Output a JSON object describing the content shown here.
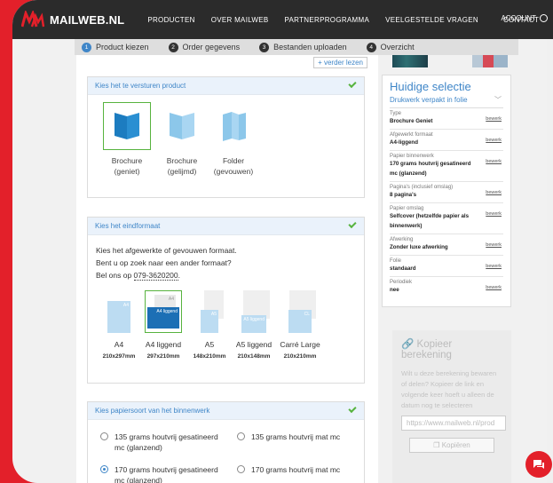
{
  "nav": {
    "brand": "MAILWEB.NL",
    "links": [
      "PRODUCTEN",
      "OVER MAILWEB",
      "PARTNERPROGRAMMA",
      "VEELGESTELDE VRAGEN",
      "CONTACT"
    ],
    "account": "ACCOUNT"
  },
  "steps": [
    {
      "num": "1",
      "label": "Product kiezen"
    },
    {
      "num": "2",
      "label": "Order gegevens"
    },
    {
      "num": "3",
      "label": "Bestanden uploaden"
    },
    {
      "num": "4",
      "label": "Overzicht"
    }
  ],
  "lezen": "+ verder lezen",
  "product_card": {
    "title": "Kies het te versturen product",
    "items": [
      {
        "line1": "Brochure",
        "line2": "(geniet)"
      },
      {
        "line1": "Brochure",
        "line2": "(gelijmd)"
      },
      {
        "line1": "Folder",
        "line2": "(gevouwen)"
      }
    ]
  },
  "format_card": {
    "title": "Kies het eindformaat",
    "text1": "Kies het afgewerkte of gevouwen formaat.",
    "text2": "Bent u op zoek naar een ander formaat?",
    "text3_prefix": "Bel ons op ",
    "phone": "079-3620200",
    "text3_suffix": ".",
    "formats": [
      {
        "label": "A4",
        "dim": "210x297mm",
        "tag": "A4"
      },
      {
        "label": "A4 liggend",
        "dim": "297x210mm",
        "tag": "A4",
        "tag2": "A4 liggend"
      },
      {
        "label": "A5",
        "dim": "148x210mm",
        "tag": "A5"
      },
      {
        "label": "A5 liggend",
        "dim": "210x148mm",
        "tag": "A5 liggend"
      },
      {
        "label": "Carré Large",
        "dim": "210x210mm",
        "tag": "CL"
      }
    ]
  },
  "paper_card": {
    "title": "Kies papiersoort van het binnenwerk",
    "options": [
      {
        "l1": "135 grams houtvrij gesatineerd",
        "l2": "mc (glanzend)"
      },
      {
        "l1": "135 grams houtvrij mat mc",
        "l2": ""
      },
      {
        "l1": "170 grams houtvrij gesatineerd",
        "l2": "mc (glanzend)"
      },
      {
        "l1": "170 grams houtvrij mat mc",
        "l2": ""
      }
    ]
  },
  "selection": {
    "title": "Huidige selectie",
    "dropdown": "Drukwerk verpakt in folie",
    "edit": "bewerk",
    "rows": [
      {
        "k": "Type",
        "v": "Brochure Geniet"
      },
      {
        "k": "Afgewerkt formaat",
        "v": "A4-liggend"
      },
      {
        "k": "Papier binnenwerk",
        "v": "170 grams houtvrij gesatineerd mc (glanzend)"
      },
      {
        "k": "Pagina's (inclusief omslag)",
        "v": "8 pagina's"
      },
      {
        "k": "Papier omslag",
        "v": "Selfcover (hetzelfde papier als binnenwerk)"
      },
      {
        "k": "Afwerking",
        "v": "Zonder luxe afwerking"
      },
      {
        "k": "Folie",
        "v": "standaard"
      },
      {
        "k": "Periodiek",
        "v": "nee"
      }
    ]
  },
  "copy": {
    "title": "Kopieer berekening",
    "text": "Wilt u deze berekening bewaren of delen? Kopieer de link en volgende keer hoeft u alleen de datum nog te selecteren",
    "input": "https://www.mailweb.nl/prod",
    "button": "Kopiëren"
  },
  "colors": {
    "accent": "#3f86c8",
    "brand": "#e3202a",
    "ok": "#57b33e"
  }
}
